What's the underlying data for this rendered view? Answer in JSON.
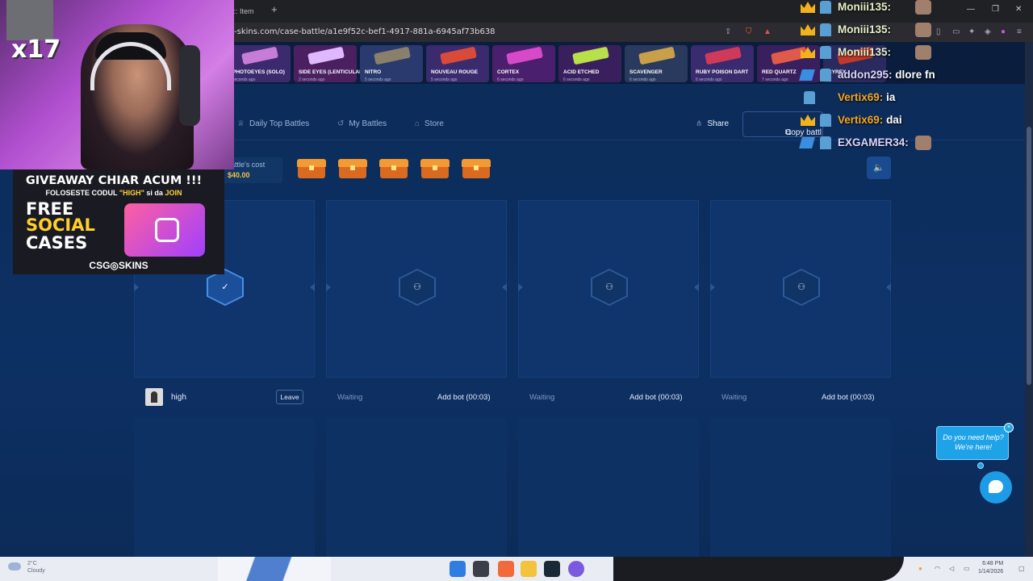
{
  "browser": {
    "tab_title": "gi :: Item",
    "new_tab": "+",
    "url": "-skins.com/case-battle/a1e9f52c-bef1-4917-881a-6945af73b638"
  },
  "live_feed": [
    {
      "name": "PHOTOEYES (SOLO)",
      "time": "seconds ago",
      "color": "#3b2a6e",
      "gun": "#c77dd8"
    },
    {
      "name": "SIDE EYES (LENTICULAR)",
      "time": "2 seconds ago",
      "color": "#4a2060",
      "gun": "#e0b8ff"
    },
    {
      "name": "NITRO",
      "time": "5 seconds ago",
      "color": "#2a3a6e",
      "gun": "#8a7f6a"
    },
    {
      "name": "NOUVEAU ROUGE",
      "time": "5 seconds ago",
      "color": "#3a2a6e",
      "gun": "#d84a3a"
    },
    {
      "name": "CORTEX",
      "time": "6 seconds ago",
      "color": "#4a1f6e",
      "gun": "#d64ac8"
    },
    {
      "name": "ACID ETCHED",
      "time": "6 seconds ago",
      "color": "#3a1f5e",
      "gun": "#b8e04a"
    },
    {
      "name": "SCAVENGER",
      "time": "6 seconds ago",
      "color": "#2a3a5e",
      "gun": "#c8a04a"
    },
    {
      "name": "RUBY POISON DART",
      "time": "6 seconds ago",
      "color": "#3a2a6e",
      "gun": "#d03a5a"
    },
    {
      "name": "RED QUARTZ",
      "time": "7 seconds ago",
      "color": "#3a1f5e",
      "gun": "#e05a4a"
    },
    {
      "name": "CYREX",
      "time": "",
      "color": "#2a2a5e",
      "gun": "#c0392b"
    }
  ],
  "subnav": {
    "daily_top": "Daily Top Battles",
    "my_battles": "My Battles",
    "store": "Store",
    "share": "Share",
    "copy": "Copy battl"
  },
  "battle": {
    "cost_label": "attle's cost",
    "cost_value": "$40.00",
    "case_count": 5
  },
  "slots": [
    {
      "state": "joined",
      "name": "high",
      "action": "Leave",
      "hex_icon": "✓"
    },
    {
      "state": "waiting",
      "name": "Waiting",
      "action": "Add bot (00:03)",
      "hex_icon": "⚇"
    },
    {
      "state": "waiting",
      "name": "Waiting",
      "action": "Add bot (00:03)",
      "hex_icon": "⚇"
    },
    {
      "state": "waiting",
      "name": "Waiting",
      "action": "Add bot (00:03)",
      "hex_icon": "⚇"
    }
  ],
  "help": {
    "line1": "Do you need help?",
    "line2": "We're here!",
    "close": "×"
  },
  "mute_icon": "🔈",
  "overlay": {
    "multiplier": "x17",
    "giveaway_title": "GIVEAWAY CHIAR ACUM !!!",
    "giveaway_code_pre": "FOLOSESTE CODUL ",
    "giveaway_code": "\"HIGH\"",
    "giveaway_code_mid": " si da ",
    "giveaway_join": "JOIN",
    "free": "FREE",
    "social": "SOCIAL",
    "cases": "CASES",
    "brand": "CSG◎SKINS"
  },
  "chat": [
    {
      "user": "Moniii135:",
      "message": "",
      "badge": "crown"
    },
    {
      "user": "Moniii135:",
      "message": "",
      "badge": "crown"
    },
    {
      "user": "Moniii135:",
      "message": "",
      "badge": "crown"
    },
    {
      "user": "addon295:",
      "message": "dlore fn",
      "badge": "tool"
    },
    {
      "user": "Vertix69:",
      "message": "ia",
      "badge": "bot"
    },
    {
      "user": "Vertix69:",
      "message": "dai",
      "badge": "crown"
    },
    {
      "user": "EXGAMER34:",
      "message": "",
      "badge": "tool"
    }
  ],
  "taskbar": {
    "temp": "2°C",
    "weather": "Cloudy",
    "time": "6:48 PM",
    "date": "1/14/2026"
  }
}
